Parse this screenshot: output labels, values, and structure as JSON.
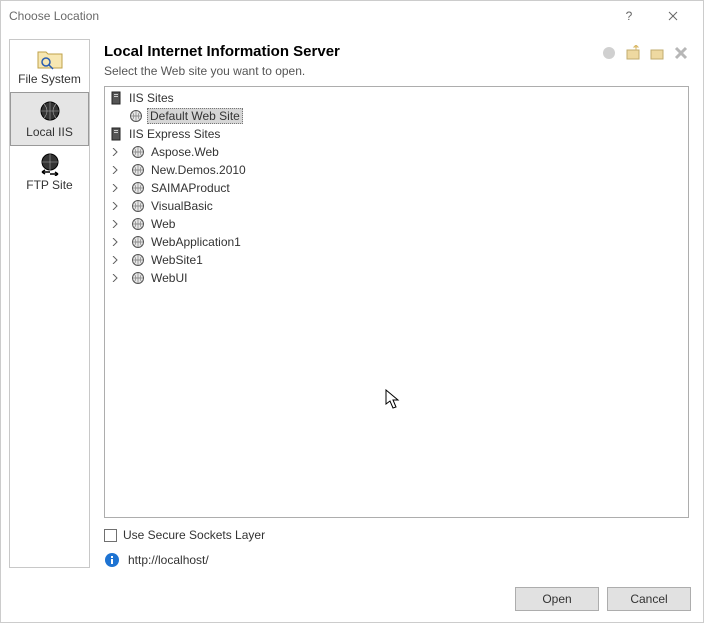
{
  "window": {
    "title": "Choose Location"
  },
  "sidebar": {
    "items": [
      {
        "label": "File System",
        "icon": "folder-search"
      },
      {
        "label": "Local IIS",
        "icon": "globe-arrows"
      },
      {
        "label": "FTP Site",
        "icon": "globe-ftp"
      }
    ],
    "selected_index": 1
  },
  "pane": {
    "title": "Local Internet Information Server",
    "subtitle": "Select the Web site you want to open."
  },
  "tree": {
    "root1_label": "IIS Sites",
    "default_site_label": "Default Web Site",
    "root2_label": "IIS Express Sites",
    "express_sites": [
      "Aspose.Web",
      "New.Demos.2010",
      "SAIMAProduct",
      "VisualBasic",
      "Web",
      "WebApplication1",
      "WebSite1",
      "WebUI"
    ]
  },
  "ssl": {
    "label": "Use Secure Sockets Layer",
    "checked": false
  },
  "url": "http://localhost/",
  "buttons": {
    "open": "Open",
    "cancel": "Cancel"
  }
}
